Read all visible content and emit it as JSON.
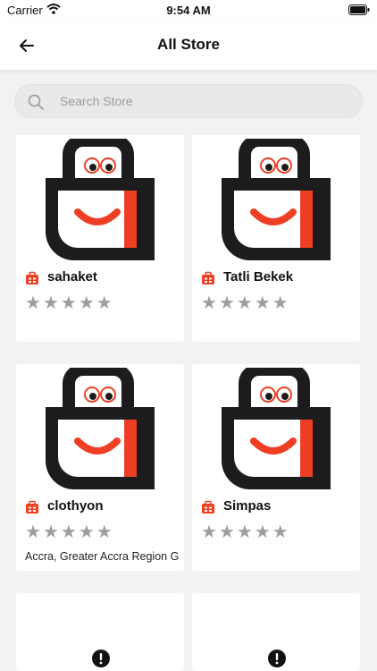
{
  "status": {
    "carrier": "Carrier",
    "time": "9:54 AM"
  },
  "header": {
    "title": "All Store"
  },
  "search": {
    "placeholder": "Search Store"
  },
  "colors": {
    "brand_red": "#ee3e23",
    "bag_black": "#1c1c1c",
    "star_gray": "#9e9e9e"
  },
  "stores": [
    {
      "name": "sahaket",
      "rating": 0,
      "location": ""
    },
    {
      "name": "Tatli Bekek",
      "rating": 0,
      "location": ""
    },
    {
      "name": "clothyon",
      "rating": 0,
      "location": "Accra, Greater Accra Region G"
    },
    {
      "name": "Simpas",
      "rating": 0,
      "location": ""
    }
  ],
  "icons": {
    "back": "arrow-left-icon",
    "search": "search-icon",
    "store_badge": "store-badge-icon",
    "star": "star-icon",
    "alert": "exclamation-circle-icon"
  }
}
